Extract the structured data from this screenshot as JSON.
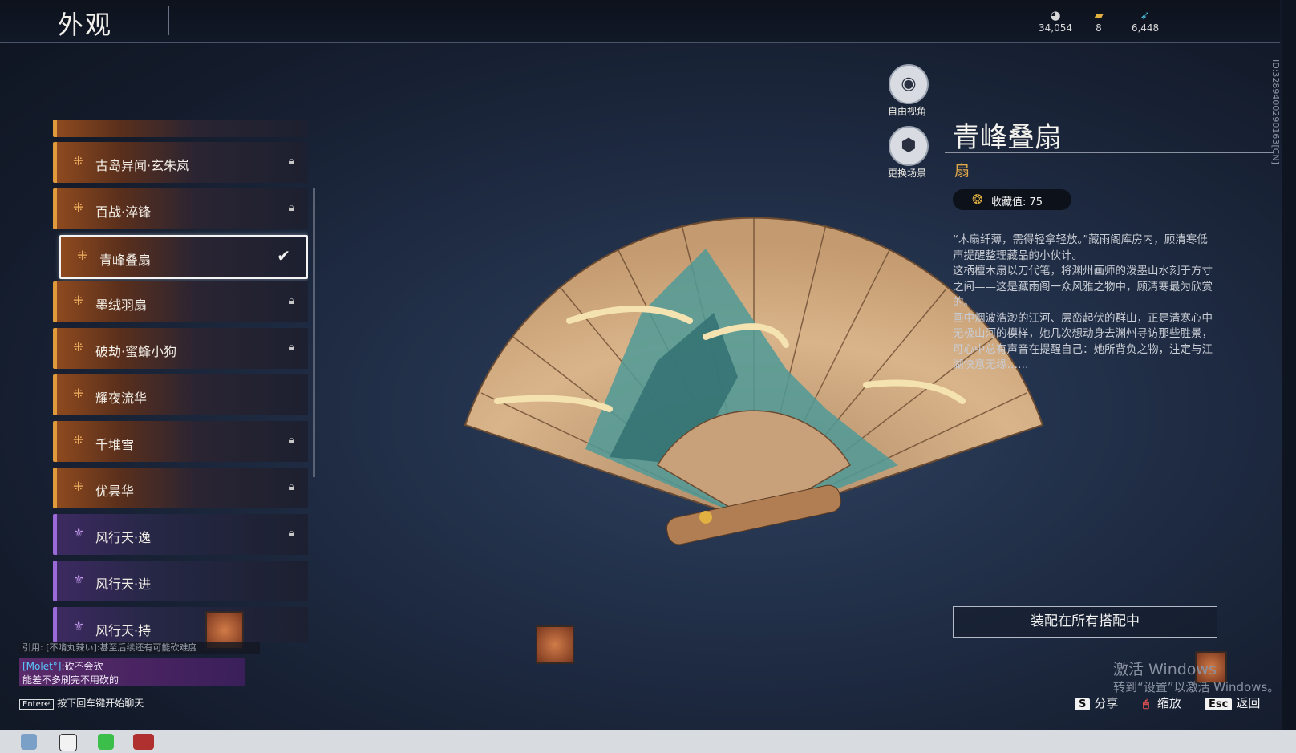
{
  "header": {
    "title": "外观"
  },
  "currencies": [
    {
      "icon": "mask-icon",
      "value": "34,054"
    },
    {
      "icon": "ticket-icon",
      "value": "8"
    },
    {
      "icon": "feather-icon",
      "value": "6,448"
    }
  ],
  "side_id": "ID:3289400290163[CN]",
  "list": {
    "items": [
      {
        "label": "古岛异闻·玄朱岚",
        "rarity": "gold",
        "locked": true
      },
      {
        "label": "百战·淬锋",
        "rarity": "gold",
        "locked": true
      },
      {
        "label": "青峰叠扇",
        "rarity": "gold",
        "selected": true
      },
      {
        "label": "墨绒羽扇",
        "rarity": "gold",
        "locked": true
      },
      {
        "label": "破劫·蜜蜂小狗",
        "rarity": "gold",
        "locked": true
      },
      {
        "label": "耀夜流华",
        "rarity": "gold",
        "locked": false
      },
      {
        "label": "千堆雪",
        "rarity": "gold",
        "locked": true
      },
      {
        "label": "优昙华",
        "rarity": "gold",
        "locked": true
      },
      {
        "label": "风行天·逸",
        "rarity": "purple",
        "locked": true
      },
      {
        "label": "风行天·进",
        "rarity": "purple",
        "locked": false
      },
      {
        "label": "风行天·持",
        "rarity": "purple",
        "locked": false
      }
    ]
  },
  "view_buttons": {
    "free_view": "自由视角",
    "change_scene": "更换场景"
  },
  "item": {
    "name": "青峰叠扇",
    "type": "扇",
    "collection_label": "收藏值: 75",
    "description": [
      "“木扇纤薄，需得轻拿轻放。”藏雨阁库房内，顾清寒低声提醒整理藏品的小伙计。",
      "这柄檀木扇以刀代笔，将渊州画师的泼墨山水刻于方寸之间——这是藏雨阁一众风雅之物中，顾清寒最为欣赏的。",
      "画中烟波浩渺的江河、层峦起伏的群山，正是清寒心中无极山河的模样，她几次想动身去渊州寻访那些胜景，可心中总有声音在提醒自己：她所背负之物，注定与江湖快意无缘……"
    ]
  },
  "equip_button": "装配在所有搭配中",
  "hints": [
    {
      "key": "S",
      "label": "分享"
    },
    {
      "key": "🖱",
      "label": "缩放"
    },
    {
      "key": "Esc",
      "label": "返回"
    }
  ],
  "chat": {
    "quote": "引用: [不啃丸辣い]:甚至后续还有可能砍难度",
    "sender": "[Molet°]",
    "line1": ":砍不会砍",
    "line2": "能差不多刷完不用砍的",
    "enter_key": "Enter↵",
    "enter_hint": "按下回车键开始聊天"
  },
  "watermark": {
    "line1": "激活 Windows",
    "line2": "转到“设置”以激活 Windows。"
  },
  "colors": {
    "gold": "#e09a3c",
    "purple": "#9a6ad8",
    "item_type": "#e0a848"
  }
}
